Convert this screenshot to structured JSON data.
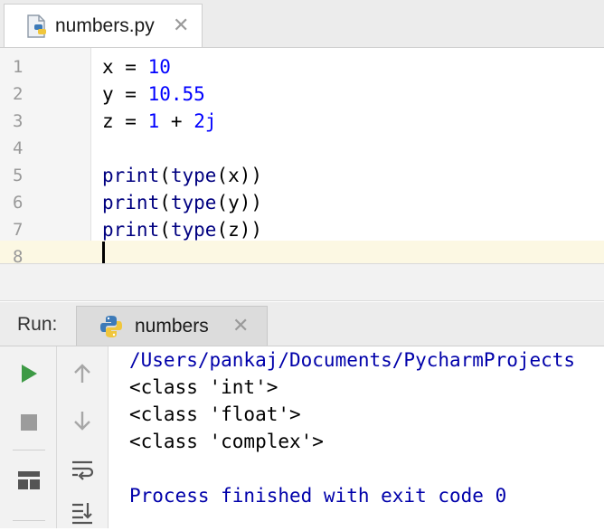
{
  "editor_tab": {
    "title": "numbers.py",
    "close": "✕"
  },
  "editor": {
    "line_numbers": [
      "1",
      "2",
      "3",
      "4",
      "5",
      "6",
      "7",
      "8"
    ],
    "line1": {
      "var": "x",
      "op": " = ",
      "val": "10"
    },
    "line2": {
      "var": "y",
      "op": " = ",
      "val": "10.55"
    },
    "line3": {
      "var": "z",
      "op": " = ",
      "a": "1",
      "plus": " + ",
      "b": "2j"
    },
    "line5": {
      "print": "print",
      "open": "(",
      "type": "type",
      "arg": "(x))"
    },
    "line6": {
      "print": "print",
      "open": "(",
      "type": "type",
      "arg": "(y))"
    },
    "line7": {
      "print": "print",
      "open": "(",
      "type": "type",
      "arg": "(z))"
    }
  },
  "run_panel": {
    "label": "Run:",
    "tab_title": "numbers",
    "close": "✕"
  },
  "console": {
    "path": "/Users/pankaj/Documents/PycharmProjects",
    "lines": [
      "<class 'int'>",
      "<class 'float'>",
      "<class 'complex'>"
    ],
    "exit": "Process finished with exit code 0"
  },
  "colors": {
    "run_green": "#3d9a45",
    "keyword_blue": "#0000ff",
    "path_blue": "#0000aa"
  }
}
